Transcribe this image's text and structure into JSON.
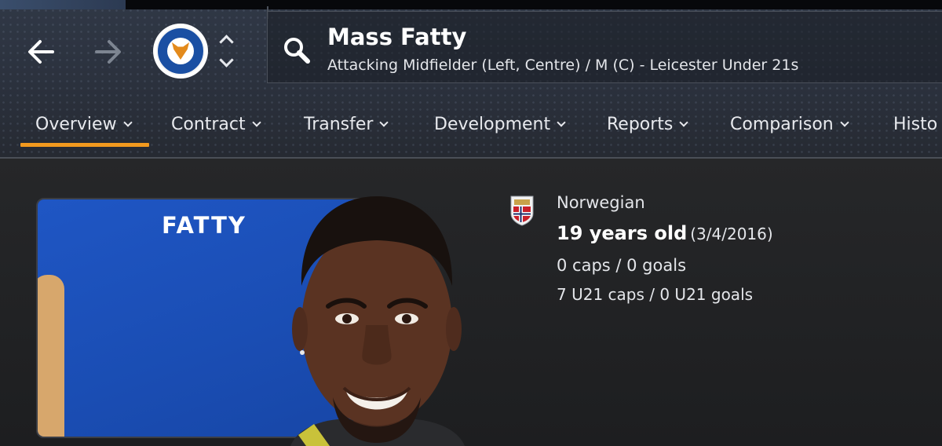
{
  "header": {
    "player_name": "Mass Fatty",
    "player_subtitle": "Attacking Midfielder (Left, Centre) / M (C) - Leicester Under 21s",
    "club_badge_icon": "leicester-city-badge",
    "club_badge_text": "LEICESTER CITY FOOTBALL CLUB"
  },
  "tabs": [
    {
      "label": "Overview",
      "active": true
    },
    {
      "label": "Contract"
    },
    {
      "label": "Transfer"
    },
    {
      "label": "Development"
    },
    {
      "label": "Reports"
    },
    {
      "label": "Comparison"
    },
    {
      "label": "Histo"
    }
  ],
  "profile": {
    "kit_name": "FATTY",
    "flag_icon": "norway-flag-badge",
    "nationality": "Norwegian",
    "age": "19 years old",
    "dob": "(3/4/2016)",
    "caps": "0 caps / 0 goals",
    "u21_caps": "7 U21 caps / 0 U21 goals"
  },
  "colors": {
    "accent": "#f29a1e",
    "kit_blue": "#1f56c4",
    "header_bg": "#2b313d",
    "body_bg": "#1e1f21"
  }
}
